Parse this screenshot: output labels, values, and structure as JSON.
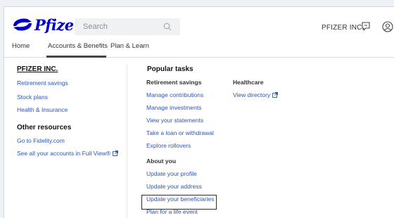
{
  "header": {
    "brand": "Pfizer",
    "search_placeholder": "Search",
    "company": "PFIZER INC."
  },
  "tabs": [
    {
      "label": "Home"
    },
    {
      "label": "Accounts & Benefits"
    },
    {
      "label": "Plan & Learn"
    }
  ],
  "sidebar": {
    "title": "PFIZER INC.",
    "links": [
      "Retirement savings",
      "Stock plans",
      "Health & Insurance"
    ],
    "other_title": "Other resources",
    "other_links": [
      "Go to Fidelity.com",
      "See all your accounts in Full View®"
    ]
  },
  "popular": {
    "title": "Popular tasks",
    "retirement_title": "Retirement savings",
    "retirement_links": [
      "Manage contributions",
      "Manage investments",
      "View your statements",
      "Take a loan or withdrawal",
      "Explore rollovers"
    ],
    "about_title": "About you",
    "about_links": [
      "Update your profile",
      "Update your address",
      "Update your beneficiaries",
      "Plan for a life event"
    ],
    "healthcare_title": "Healthcare",
    "healthcare_link": "View directory"
  },
  "colors": {
    "brand": "#0000c9",
    "link": "#2a55b8",
    "highlight": "#1b17c4"
  }
}
